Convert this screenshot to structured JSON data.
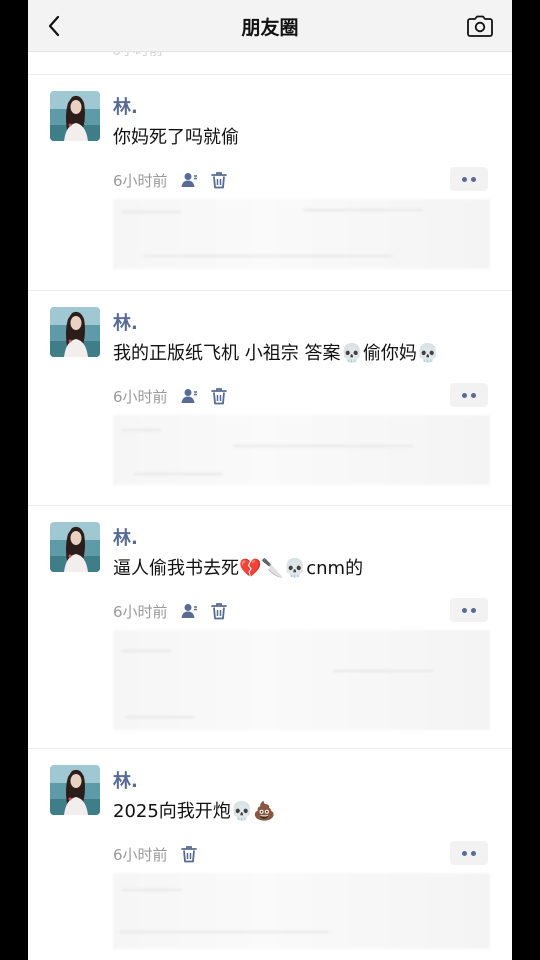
{
  "navbar": {
    "title": "朋友圈"
  },
  "ghost_time": "6小时前",
  "posts": [
    {
      "name": "林.",
      "content": "你妈死了吗就偷",
      "time": "6小时前"
    },
    {
      "name": "林.",
      "content": "我的正版纸飞机 小祖宗 答案💀偷你妈💀",
      "time": "6小时前"
    },
    {
      "name": "林.",
      "content": "逼人偷我书去死💔🔪💀cnm的",
      "time": "6小时前"
    },
    {
      "name": "林.",
      "content": "2025向我开炮💀💩",
      "time": "6小时前"
    }
  ],
  "icons": {
    "back": "back-chevron-icon",
    "camera": "camera-icon",
    "visibility": "person-visibility-icon",
    "delete": "trash-icon",
    "more": "more-dots-icon"
  },
  "colors": {
    "name": "#576b95",
    "time": "#9a9a9a",
    "navbar": "#f3f3f3"
  }
}
